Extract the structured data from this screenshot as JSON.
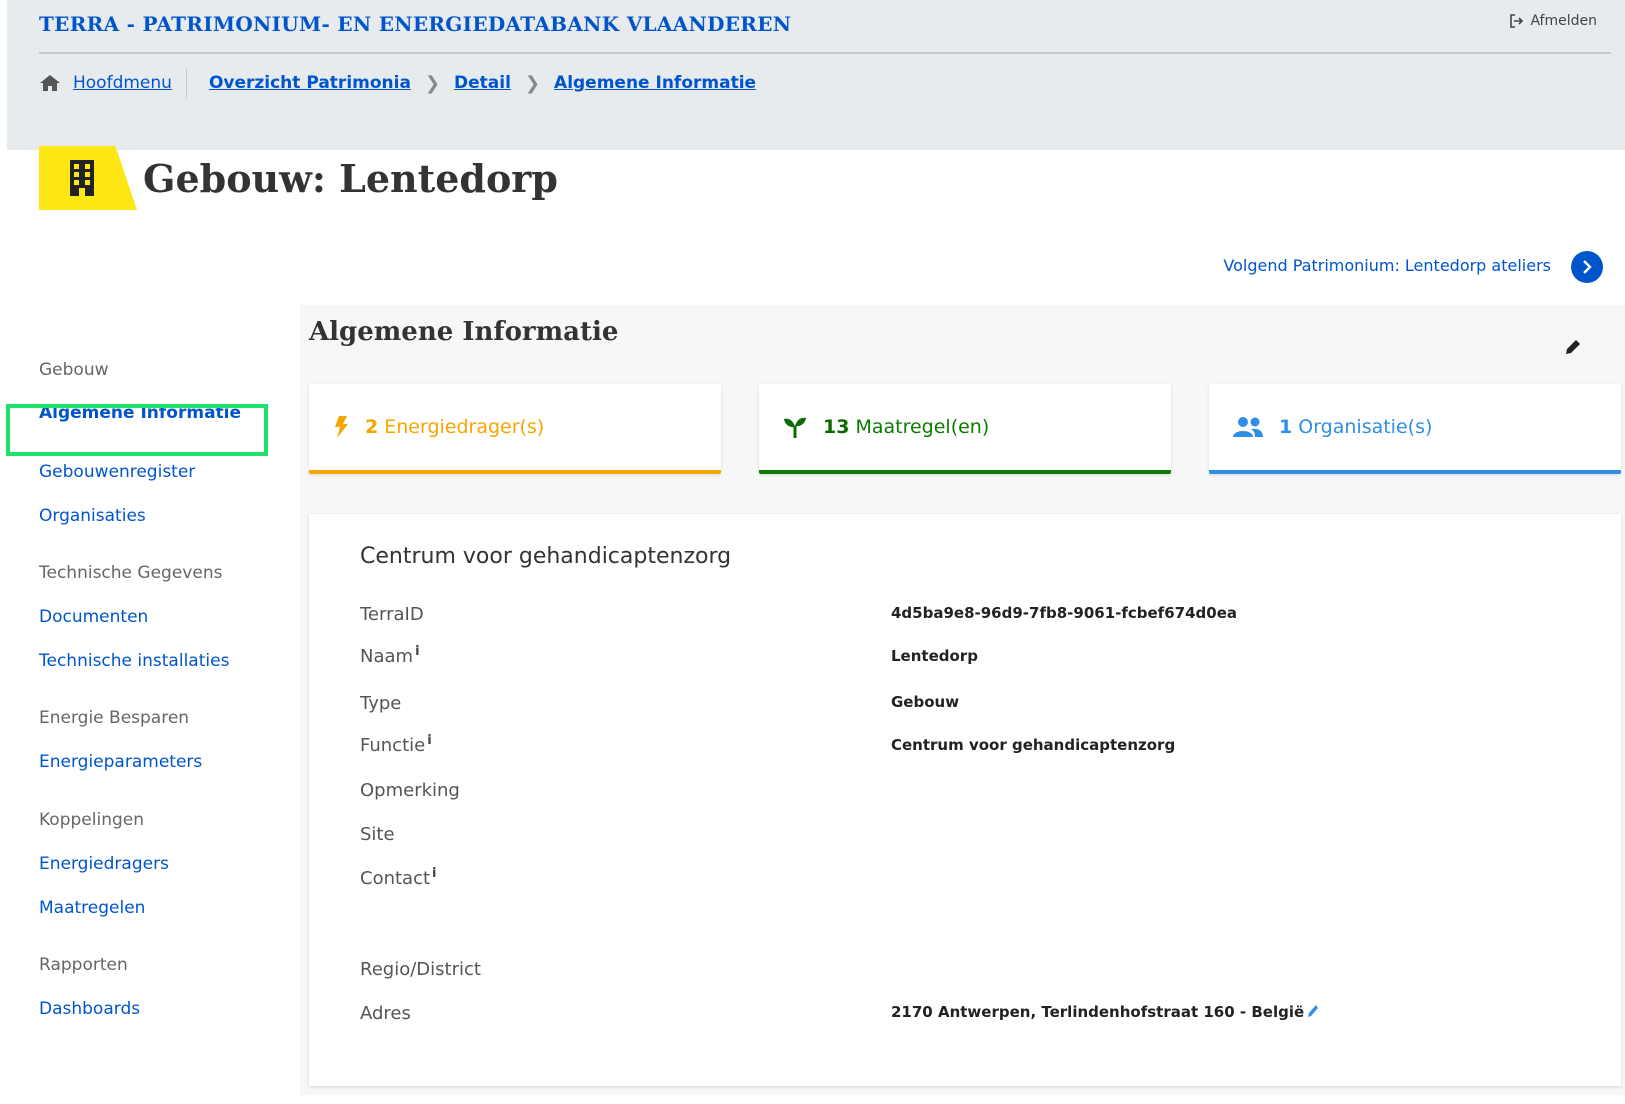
{
  "header": {
    "site_title": "TERRA - PATRIMONIUM- EN ENERGIEDATABANK VLAANDEREN",
    "logout_label": "Afmelden"
  },
  "breadcrumb": {
    "home": "Hoofdmenu",
    "items": [
      "Overzicht Patrimonia",
      "Detail",
      "Algemene Informatie"
    ]
  },
  "page": {
    "title": "Gebouw: Lentedorp",
    "next_link": "Volgend Patrimonium: Lentedorp ateliers"
  },
  "sidebar": {
    "groups": [
      {
        "label": "Gebouw",
        "items": [
          "Algemene Informatie",
          "Gebouwenregister",
          "Organisaties"
        ]
      },
      {
        "label": "Technische Gegevens",
        "items": [
          "Documenten",
          "Technische installaties"
        ]
      },
      {
        "label": "Energie Besparen",
        "items": [
          "Energieparameters"
        ]
      },
      {
        "label": "Koppelingen",
        "items": [
          "Energiedragers",
          "Maatregelen"
        ]
      },
      {
        "label": "Rapporten",
        "items": [
          "Dashboards"
        ]
      }
    ],
    "active": "Algemene Informatie"
  },
  "section": {
    "title": "Algemene Informatie"
  },
  "stats": [
    {
      "count": "2",
      "label": "Energiedrager(s)",
      "icon": "bolt-icon",
      "color": "#f7a600"
    },
    {
      "count": "13",
      "label": "Maatregel(en)",
      "icon": "sprout-icon",
      "color": "#0a7d00"
    },
    {
      "count": "1",
      "label": "Organisatie(s)",
      "icon": "users-icon",
      "color": "#2f8ee5"
    }
  ],
  "info": {
    "heading": "Centrum voor gehandicaptenzorg",
    "fields": {
      "terraid": {
        "label": "TerraID",
        "value": "4d5ba9e8-96d9-7fb8-9061-fcbef674d0ea"
      },
      "naam": {
        "label": "Naam",
        "value": "Lentedorp",
        "info": "i"
      },
      "type": {
        "label": "Type",
        "value": "Gebouw"
      },
      "functie": {
        "label": "Functie",
        "value": "Centrum voor gehandicaptenzorg",
        "info": "i"
      },
      "opmerking": {
        "label": "Opmerking",
        "value": ""
      },
      "site": {
        "label": "Site",
        "value": ""
      },
      "contact": {
        "label": "Contact",
        "value": "",
        "info": "i"
      },
      "regio": {
        "label": "Regio/District",
        "value": ""
      },
      "adres": {
        "label": "Adres",
        "value": "2170 Antwerpen, Terlindenhofstraat 160 - België"
      }
    }
  },
  "colors": {
    "primary": "#0055cc",
    "yellow": "#ffe615",
    "highlight": "#1fe06c"
  }
}
